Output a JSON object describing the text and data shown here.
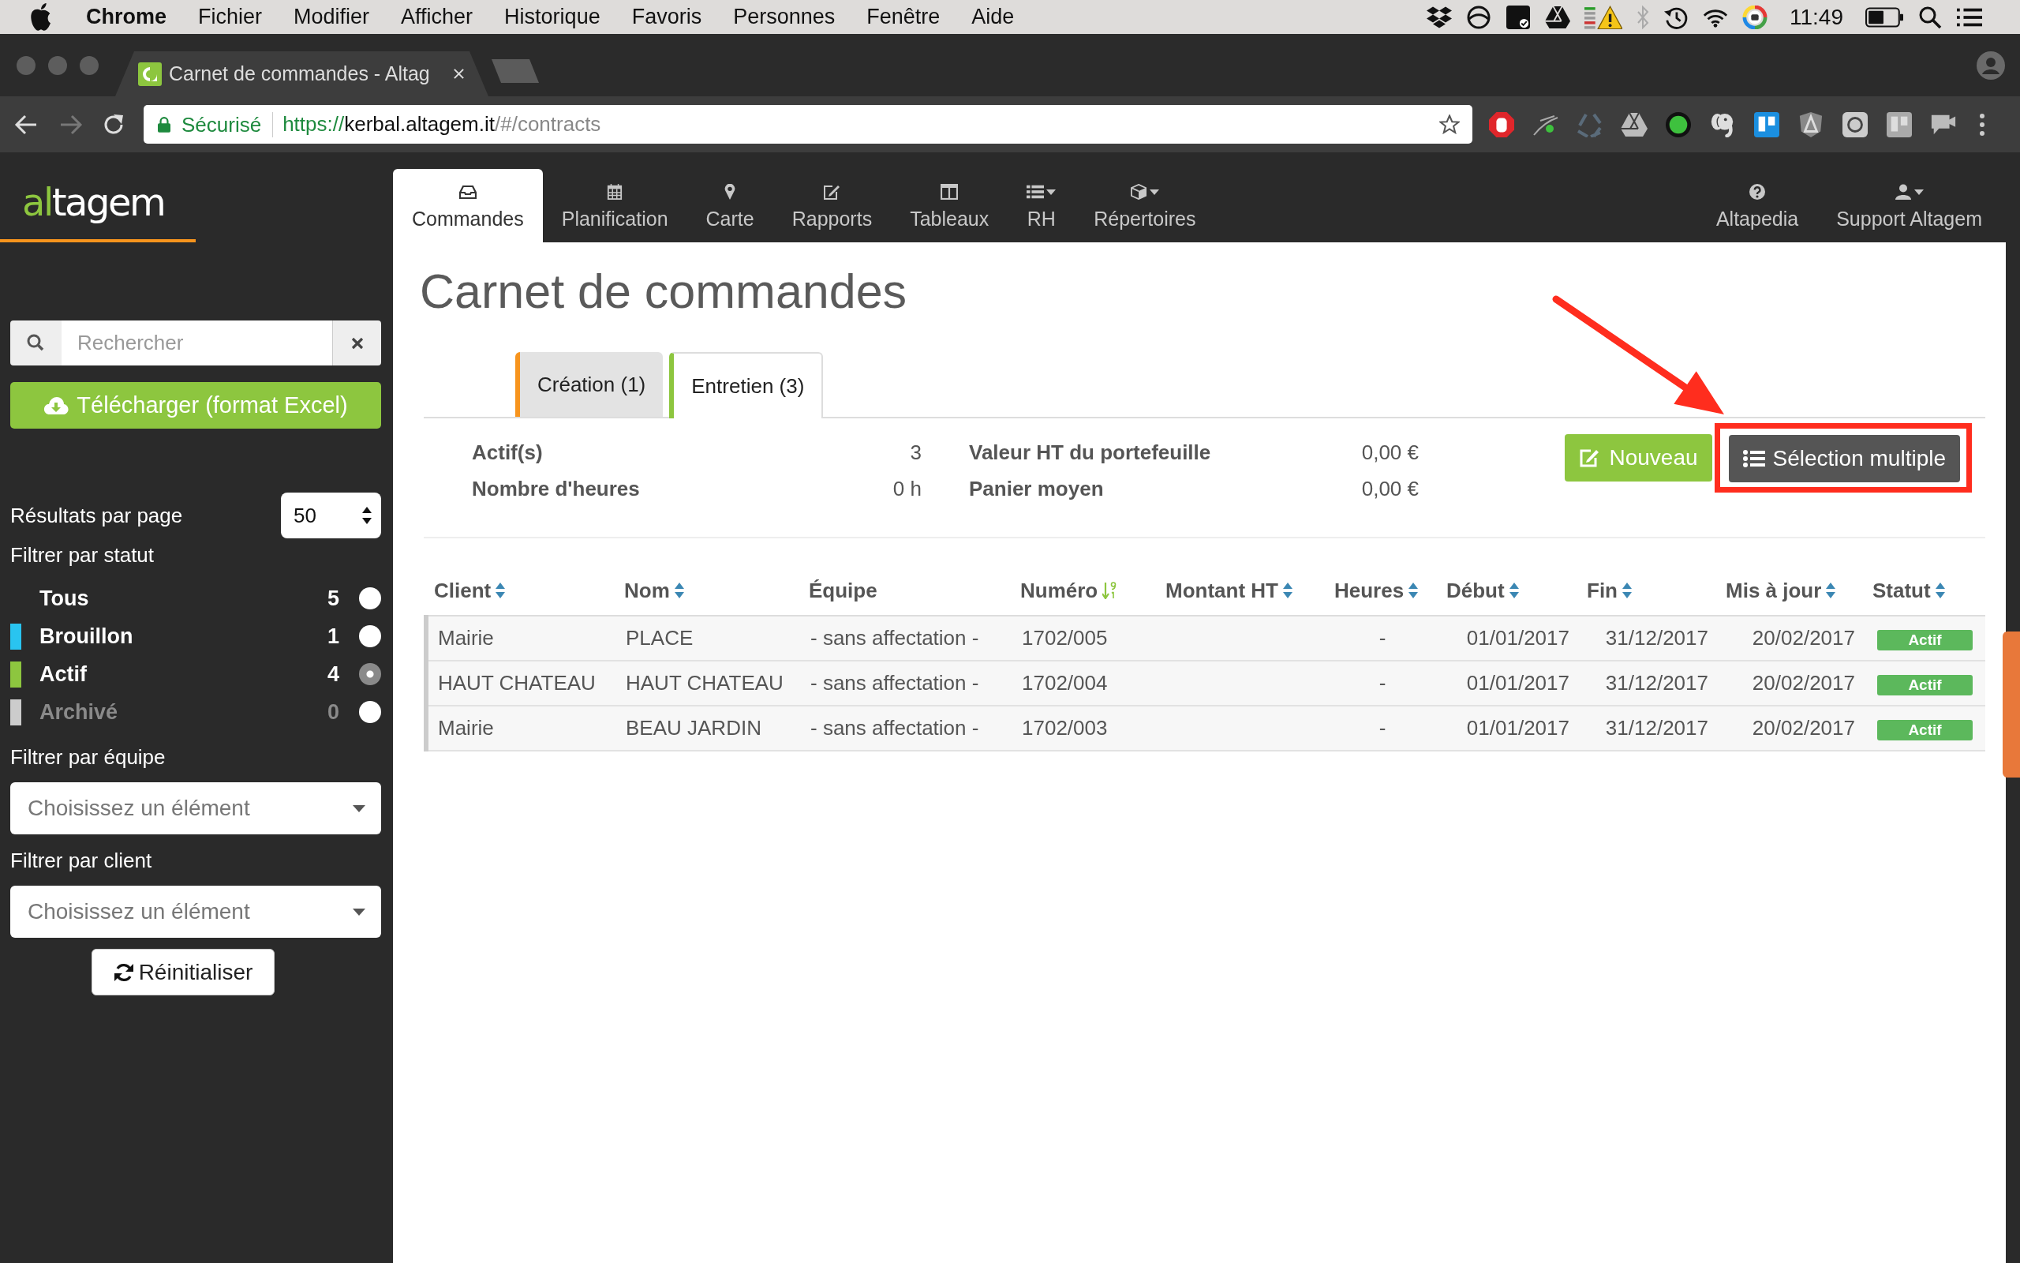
{
  "menu_bar": {
    "app": "Chrome",
    "items": [
      "Fichier",
      "Modifier",
      "Afficher",
      "Historique",
      "Favoris",
      "Personnes",
      "Fenêtre",
      "Aide"
    ],
    "clock": "11:49"
  },
  "browser": {
    "tab": {
      "title": "Carnet de commandes - Altag",
      "selected": true
    },
    "security": "Sécurisé",
    "url": {
      "scheme": "https://",
      "host": "kerbal.altagem.it",
      "path": "/#/contracts"
    }
  },
  "sidebar": {
    "logo": {
      "accent": "al",
      "rest": "tagem"
    },
    "search": {
      "placeholder": "Rechercher"
    },
    "download_button": "Télécharger (format Excel)",
    "per_page": {
      "label": "Résultats par page",
      "value": "50"
    },
    "status_filter": {
      "label": "Filtrer par statut",
      "items": [
        {
          "label": "Tous",
          "count": "5",
          "selected": false,
          "disabled": false
        },
        {
          "label": "Brouillon",
          "count": "1",
          "color": "#29c4f0",
          "selected": false,
          "disabled": false
        },
        {
          "label": "Actif",
          "count": "4",
          "color": "#8dc63f",
          "selected": true,
          "disabled": false
        },
        {
          "label": "Archivé",
          "count": "0",
          "color": "#cccccc",
          "selected": false,
          "disabled": true
        }
      ]
    },
    "team_filter": {
      "label": "Filtrer par équipe",
      "placeholder": "Choisissez un élément"
    },
    "client_filter": {
      "label": "Filtrer par client",
      "placeholder": "Choisissez un élément"
    },
    "reset_button": "Réinitialiser"
  },
  "nav": {
    "items": [
      {
        "label": "Commandes",
        "selected": true,
        "dropdown": false
      },
      {
        "label": "Planification",
        "selected": false,
        "dropdown": false
      },
      {
        "label": "Carte",
        "selected": false,
        "dropdown": false
      },
      {
        "label": "Rapports",
        "selected": false,
        "dropdown": false
      },
      {
        "label": "Tableaux",
        "selected": false,
        "dropdown": false
      },
      {
        "label": "RH",
        "selected": false,
        "dropdown": true
      },
      {
        "label": "Répertoires",
        "selected": false,
        "dropdown": true
      }
    ],
    "right_items": [
      {
        "label": "Altapedia",
        "selected": false,
        "dropdown": false
      },
      {
        "label": "Support Altagem",
        "selected": false,
        "dropdown": true
      }
    ]
  },
  "page": {
    "title": "Carnet de commandes",
    "tabs": [
      {
        "label": "Création (1)",
        "color": "#f7941d",
        "selected": false
      },
      {
        "label": "Entretien (3)",
        "color": "#8dc63f",
        "selected": true
      }
    ],
    "summary": [
      [
        {
          "label": "Actif(s)",
          "value": "3"
        },
        {
          "label": "Nombre d'heures",
          "value": "0 h"
        }
      ],
      [
        {
          "label": "Valeur HT du portefeuille",
          "value": "0,00 €"
        },
        {
          "label": "Panier moyen",
          "value": "0,00 €"
        }
      ]
    ],
    "actions": [
      {
        "label": "Nouveau",
        "kind": "new",
        "highlighted": false
      },
      {
        "label": "Sélection multiple",
        "kind": "select",
        "highlighted": true
      }
    ]
  },
  "table": {
    "columns": [
      {
        "label": "Client",
        "sortable": true,
        "sorted": false
      },
      {
        "label": "Nom",
        "sortable": true,
        "sorted": false
      },
      {
        "label": "Équipe",
        "sortable": false,
        "sorted": false
      },
      {
        "label": "Numéro",
        "sortable": true,
        "sorted": true
      },
      {
        "label": "Montant HT",
        "sortable": true,
        "sorted": false
      },
      {
        "label": "Heures",
        "sortable": true,
        "sorted": false
      },
      {
        "label": "Début",
        "sortable": true,
        "sorted": false
      },
      {
        "label": "Fin",
        "sortable": true,
        "sorted": false
      },
      {
        "label": "Mis à jour",
        "sortable": true,
        "sorted": false
      },
      {
        "label": "Statut",
        "sortable": true,
        "sorted": false
      }
    ],
    "rows": [
      {
        "client": "Mairie",
        "nom": "PLACE",
        "equipe": "- sans affectation -",
        "numero": "1702/005",
        "heures": "-",
        "debut": "01/01/2017",
        "fin": "31/12/2017",
        "mis_a_jour": "20/02/2017",
        "statut": "Actif"
      },
      {
        "client": "HAUT CHATEAU",
        "nom": "HAUT CHATEAU",
        "equipe": "- sans affectation -",
        "numero": "1702/004",
        "heures": "-",
        "debut": "01/01/2017",
        "fin": "31/12/2017",
        "mis_a_jour": "20/02/2017",
        "statut": "Actif"
      },
      {
        "client": "Mairie",
        "nom": "BEAU JARDIN",
        "equipe": "- sans affectation -",
        "numero": "1702/003",
        "heures": "-",
        "debut": "01/01/2017",
        "fin": "31/12/2017",
        "mis_a_jour": "20/02/2017",
        "statut": "Actif"
      }
    ]
  }
}
